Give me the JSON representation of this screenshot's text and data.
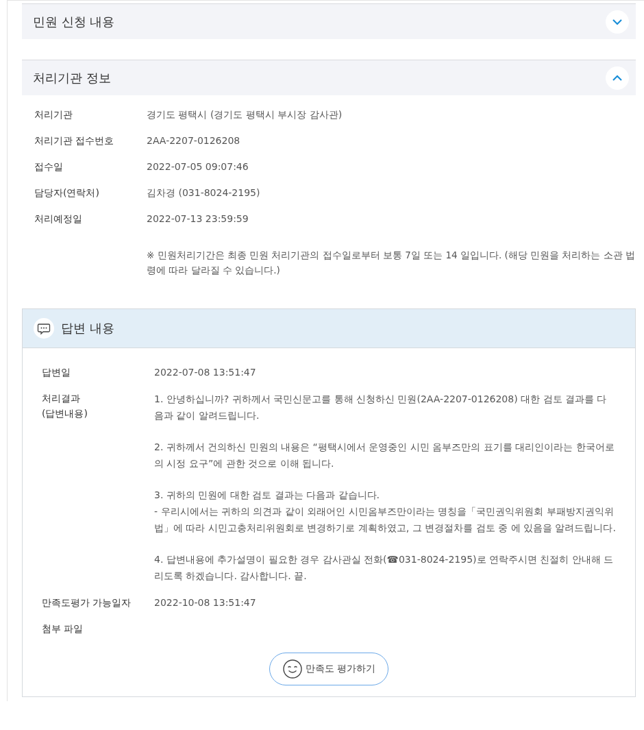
{
  "sections": [
    {
      "title": "민원 신청 내용",
      "expanded": false
    },
    {
      "title": "처리기관 정보",
      "expanded": true
    }
  ],
  "agency_info": {
    "rows": [
      {
        "label": "처리기관",
        "value": "경기도 평택시 (경기도 평택시 부시장 감사관)"
      },
      {
        "label": "처리기관 접수번호",
        "value": "2AA-2207-0126208"
      },
      {
        "label": "접수일",
        "value": "2022-07-05 09:07:46"
      },
      {
        "label": "담당자(연락처)",
        "value": "김차경 (031-8024-2195)"
      },
      {
        "label": "처리예정일",
        "value": "2022-07-13 23:59:59"
      }
    ],
    "note": "※ 민원처리기간은 최종 민원 처리기관의 접수일로부터 보통 7일 또는 14 일입니다. (해당 민원을 처리하는 소관 법령에 따라 달라질 수 있습니다.)"
  },
  "answer": {
    "title": "답변 내용",
    "date_label": "답변일",
    "date": "2022-07-08 13:51:47",
    "result_label": [
      "처리결과",
      "(답변내용)"
    ],
    "paragraphs": [
      [
        "1. 안녕하십니까? 귀하께서 국민신문고를 통해 신청하신 민원(2AA-2207-0126208) 대한 검토 결과를 다음과 같이 알려드립니다."
      ],
      [
        "2. 귀하께서 건의하신 민원의 내용은 “평택시에서 운영중인 시민 옴부즈만의 표기를 대리인이라는 한국어로의 시정 요구”에 관한 것으로 이해 됩니다."
      ],
      [
        "3. 귀하의 민원에 대한 검토 결과는 다음과 같습니다.",
        "- 우리시에서는 귀하의 의견과 같이 외래어인 시민옴부즈만이라는 명칭을「국민권익위원회 부패방지권익위법」에 따라 시민고충처리위원회로 변경하기로 계획하였고, 그 변경절차를 검토 중 에 있음을 알려드립니다."
      ],
      [
        "4. 답변내용에 추가설명이 필요한 경우 감사관실 전화(☎031-8024-2195)로 연락주시면 친절히 안내해 드리도록 하겠습니다. 감사합니다. 끝."
      ]
    ],
    "rating_label": "만족도평가 가능일자",
    "rating_date": "2022-10-08 13:51:47",
    "attachment_label": "첨부 파일",
    "rate_button": "만족도 평가하기"
  }
}
